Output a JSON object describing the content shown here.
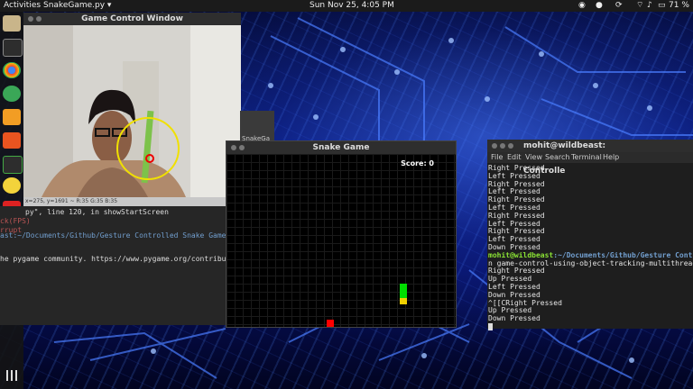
{
  "topbar": {
    "activities": "Activities",
    "app_menu": "SnakeGame.py ▾",
    "clock": "Sun Nov 25,  4:05 PM",
    "battery": "71 %"
  },
  "camera_window": {
    "title": "Game Control Window",
    "status_text": "x=275, y=1691 ~ R:35 G:35 B:35"
  },
  "back_terminal": {
    "lines": [
      "py\", line 120, in showStartScreen",
      "ck(FPS)",
      "rrupt",
      "ast:~/Documents/Github/Gesture Controlled Snake Game$ pyt",
      "he pygame community. https://www.pygame.org/contribute.ht"
    ]
  },
  "partial_window": {
    "title": "SnakeGa"
  },
  "snake_window": {
    "title": "Snake Game",
    "score_label": "Score: 0",
    "snake_color": "#00dd00",
    "snake_head_color": "#f0d000",
    "apple_color": "#ff0000"
  },
  "right_terminal": {
    "title": "mohit@wildbeast: ~/Documents/Github/Gesture Controlle",
    "menu": [
      "File",
      "Edit",
      "View",
      "Search",
      "Terminal",
      "Help"
    ],
    "lines_before": [
      "Right Pressed",
      "Left Pressed",
      "Right Pressed",
      "Left Pressed",
      "Right Pressed",
      "Left Pressed",
      "Right Pressed",
      "Left Pressed",
      "Right Pressed",
      "Left Pressed",
      "Down Pressed"
    ],
    "prompt_user": "mohit@wildbeast",
    "prompt_path": ":~/Documents/Github/Gesture Controlle",
    "command": "n game-control-using-object-tracking-multithreaded.p",
    "lines_after": [
      "Right Pressed",
      "Up Pressed",
      "Left Pressed",
      "Down Pressed",
      "^[[CRight Pressed",
      "Up Pressed",
      "Down Pressed"
    ]
  }
}
